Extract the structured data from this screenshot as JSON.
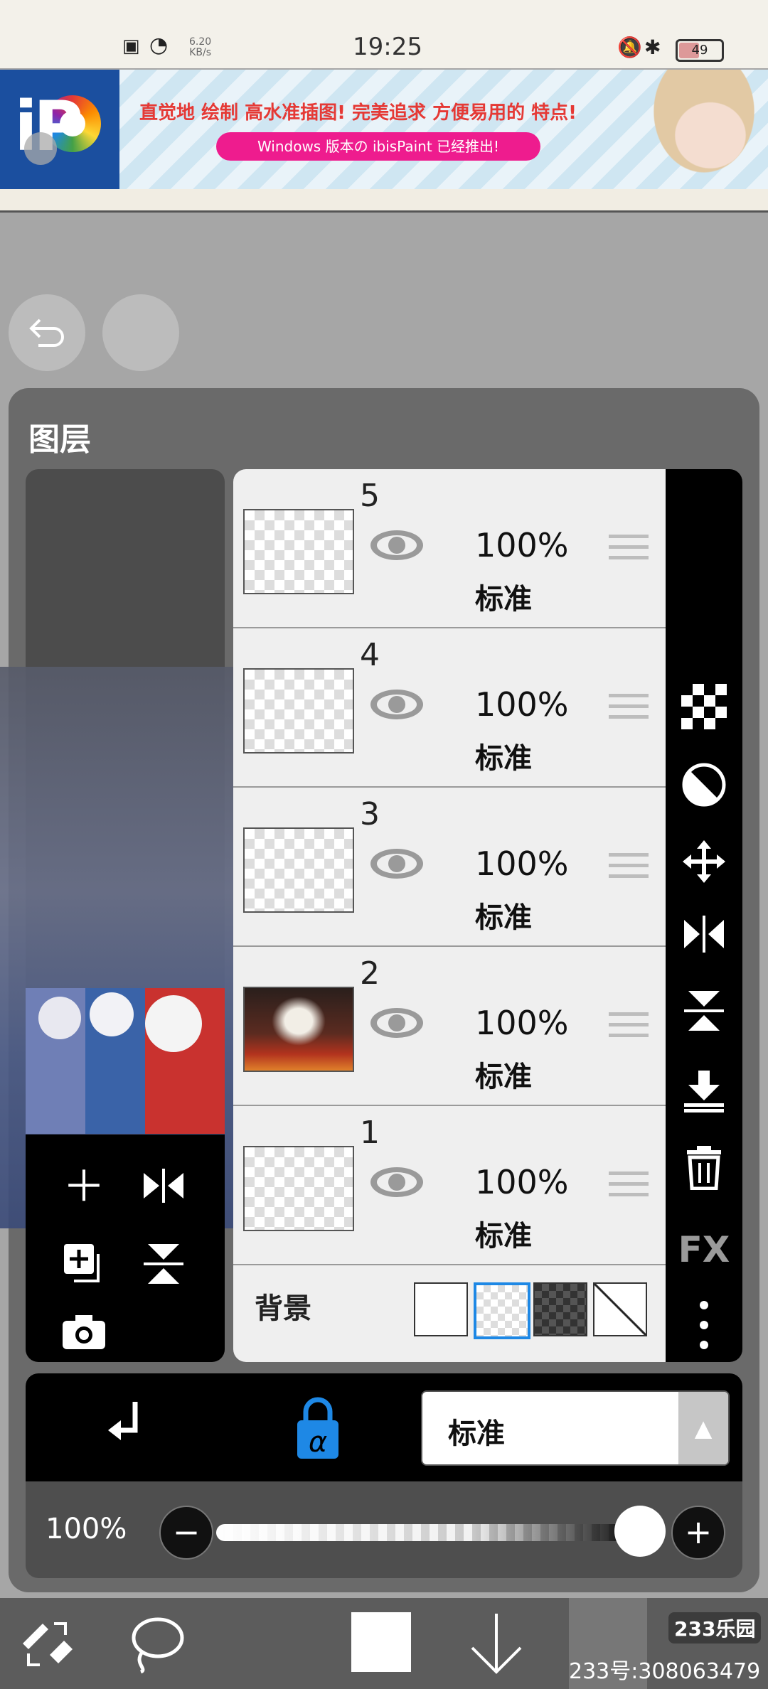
{
  "status_bar": {
    "time": "19:25",
    "net_speed": "6.20",
    "net_unit": "KB/s",
    "battery": "49"
  },
  "ad": {
    "headline": "直觉地 绘制 高水准插图! 完美追求 方便易用的 特点!",
    "subline": "Windows 版本の ibisPaint 已经推出!",
    "logo_text": "iP"
  },
  "panel": {
    "title": "图层"
  },
  "layers": [
    {
      "number": "5",
      "opacity": "100%",
      "mode": "标准",
      "thumb": "empty"
    },
    {
      "number": "4",
      "opacity": "100%",
      "mode": "标准",
      "thumb": "empty"
    },
    {
      "number": "3",
      "opacity": "100%",
      "mode": "标准",
      "thumb": "empty"
    },
    {
      "number": "2",
      "opacity": "100%",
      "mode": "标准",
      "thumb": "photo"
    },
    {
      "number": "1",
      "opacity": "100%",
      "mode": "标准",
      "thumb": "empty"
    }
  ],
  "background": {
    "label": "背景",
    "options": [
      "white",
      "transparent",
      "dark-checker",
      "none"
    ],
    "selected": "transparent"
  },
  "right_tools": [
    "checker-icon",
    "invert-icon",
    "move-icon",
    "flip-horizontal-icon",
    "flip-vertical-icon",
    "merge-down-icon",
    "trash-icon",
    "fx-icon",
    "more-icon"
  ],
  "right_tools_fx_label": "FX",
  "blend": {
    "mode_label": "标准",
    "alpha_lock_label": "α"
  },
  "opacity": {
    "value_label": "100%",
    "minus": "−",
    "plus": "+",
    "value": 1.0
  },
  "watermark": {
    "logo": "233乐园",
    "text": "233号:308063479"
  },
  "colors": {
    "accent_blue": "#1e88e5",
    "panel": "#6a6a6a",
    "strip": "#000000"
  }
}
